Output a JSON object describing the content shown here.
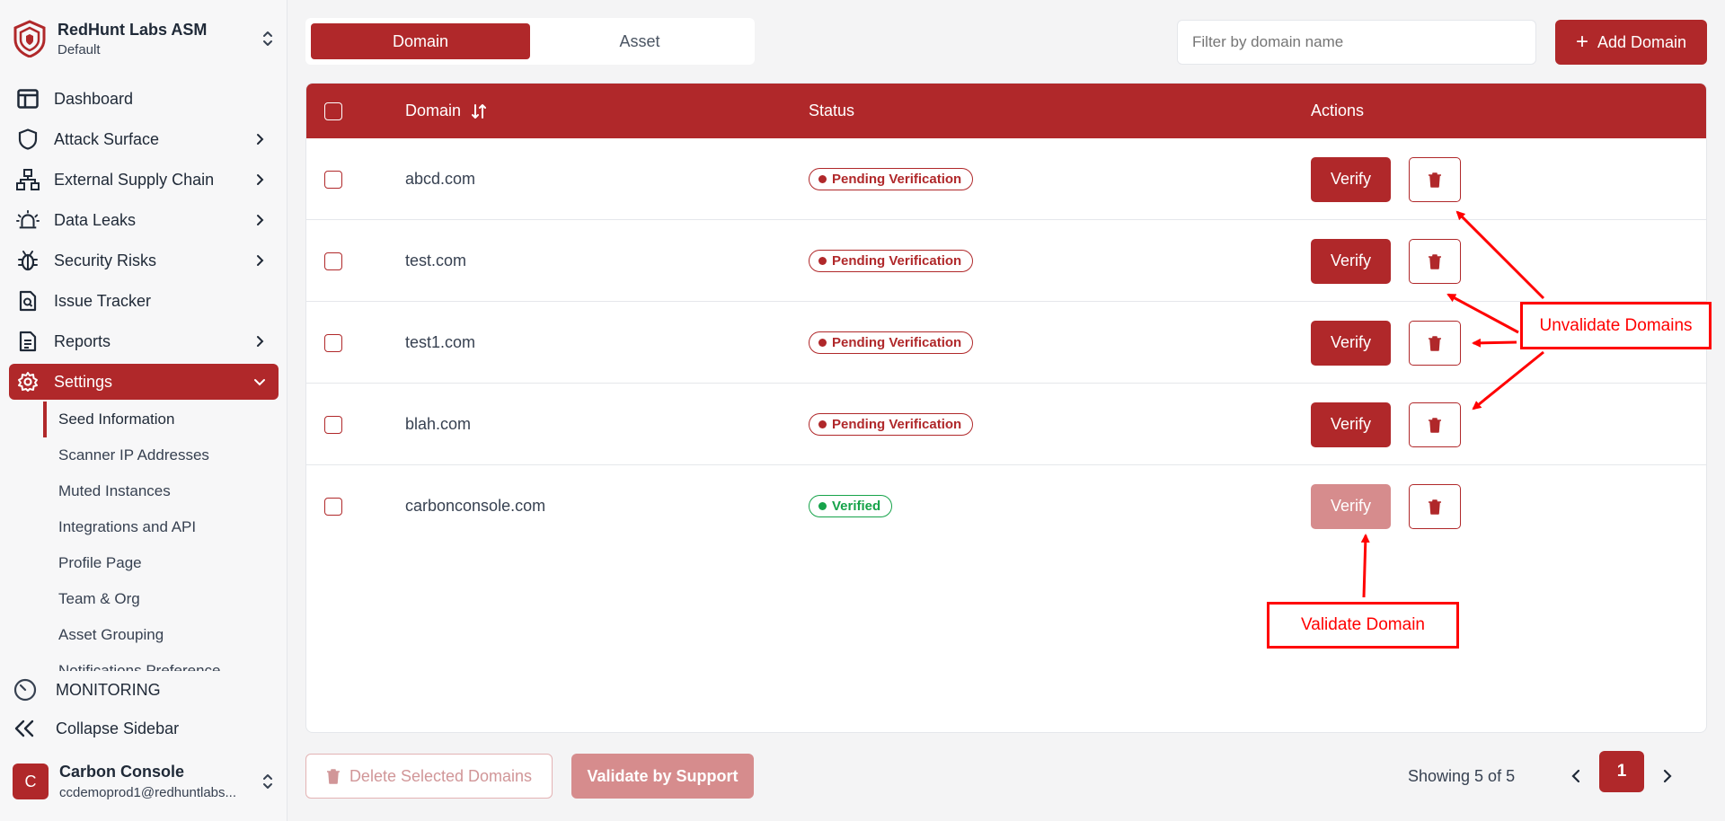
{
  "org": {
    "name": "RedHunt Labs ASM",
    "workspace": "Default"
  },
  "nav": [
    {
      "label": "Dashboard",
      "icon": "layout-icon"
    },
    {
      "label": "Attack Surface",
      "icon": "shield-icon"
    },
    {
      "label": "External Supply Chain",
      "icon": "network-icon"
    },
    {
      "label": "Data Leaks",
      "icon": "siren-icon"
    },
    {
      "label": "Security Risks",
      "icon": "bug-icon"
    },
    {
      "label": "Issue Tracker",
      "icon": "file-search-icon"
    },
    {
      "label": "Reports",
      "icon": "document-icon"
    },
    {
      "label": "Settings",
      "icon": "gear-icon"
    }
  ],
  "settings_sub": [
    "Seed Information",
    "Scanner IP Addresses",
    "Muted Instances",
    "Integrations and API",
    "Profile Page",
    "Team & Org",
    "Asset Grouping",
    "Notifications Preference"
  ],
  "monitoring_label": "MONITORING",
  "collapse_label": "Collapse Sidebar",
  "user": {
    "initial": "C",
    "name": "Carbon Console",
    "email": "ccdemoprod1@redhuntlabs..."
  },
  "tabs": [
    "Domain",
    "Asset"
  ],
  "filter_placeholder": "Filter by domain name",
  "add_domain_label": "Add Domain",
  "table": {
    "headers": {
      "domain": "Domain",
      "status": "Status",
      "actions": "Actions"
    },
    "rows": [
      {
        "domain": "abcd.com",
        "status": "Pending Verification",
        "verified": false
      },
      {
        "domain": "test.com",
        "status": "Pending Verification",
        "verified": false
      },
      {
        "domain": "test1.com",
        "status": "Pending Verification",
        "verified": false
      },
      {
        "domain": "blah.com",
        "status": "Pending Verification",
        "verified": false
      },
      {
        "domain": "carbonconsole.com",
        "status": "Verified",
        "verified": true
      }
    ],
    "verify_label": "Verify"
  },
  "footer": {
    "delete_label": "Delete Selected Domains",
    "validate_label": "Validate by Support",
    "showing": "Showing 5 of 5",
    "current_page": "1"
  },
  "annotations": {
    "unvalidate": "Unvalidate Domains",
    "validate": "Validate Domain"
  },
  "colors": {
    "brand": "#b0282a",
    "annotation": "#ff0000",
    "verified": "#16a34a"
  }
}
